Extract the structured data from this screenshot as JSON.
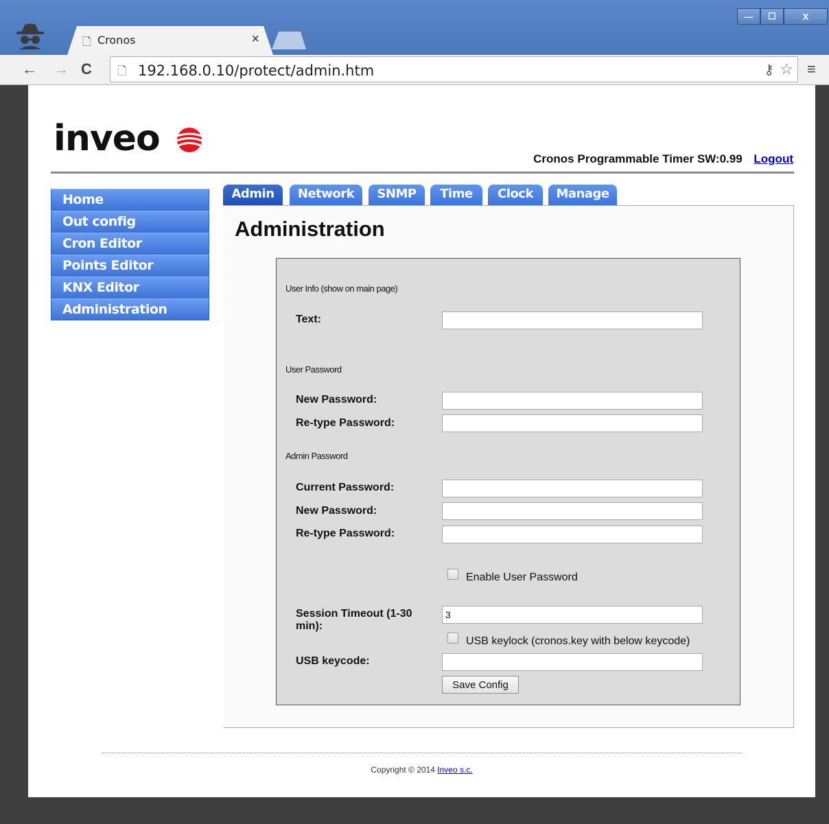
{
  "browser": {
    "tab_title": "Cronos",
    "tab_close": "×",
    "url": "192.168.0.10/protect/admin.htm",
    "window_controls": {
      "minimize": "—",
      "maximize": "☐",
      "close": "X"
    }
  },
  "header": {
    "logo_text": "inveo",
    "info": "Cronos Programmable Timer SW:0.99",
    "logout": "Logout"
  },
  "sidebar": {
    "items": [
      {
        "label": "Home"
      },
      {
        "label": "Out config"
      },
      {
        "label": "Cron Editor"
      },
      {
        "label": "Points Editor"
      },
      {
        "label": "KNX Editor"
      },
      {
        "label": "Administration"
      }
    ]
  },
  "tabs": [
    {
      "label": "Admin",
      "active": true
    },
    {
      "label": "Network"
    },
    {
      "label": "SNMP"
    },
    {
      "label": "Time"
    },
    {
      "label": "Clock"
    },
    {
      "label": "Manage"
    }
  ],
  "main": {
    "title": "Administration",
    "form": {
      "section_user_info": "User Info (show on main page)",
      "text_label": "Text:",
      "text_value": "",
      "section_user_password": "User Password",
      "user_new_password_label": "New Password:",
      "user_retype_password_label": "Re-type Password:",
      "section_admin_password": "Admin Password",
      "current_password_label": "Current Password:",
      "admin_new_password_label": "New Password:",
      "admin_retype_password_label": "Re-type Password:",
      "enable_user_password_label": "Enable User Password",
      "enable_user_password_checked": false,
      "session_timeout_label": "Session Timeout (1-30 min):",
      "session_timeout_value": "3",
      "usb_keylock_label": "USB keylock (cronos.key with below keycode)",
      "usb_keylock_checked": false,
      "usb_keycode_label": "USB keycode:",
      "usb_keycode_value": "",
      "save_button": "Save Config"
    }
  },
  "footer": {
    "copyright": "Copyright © 2014",
    "link": "Inveo s.c."
  },
  "colors": {
    "menu_blue": "#4a7fe0",
    "tab_active": "#2a5bc0",
    "logo_red": "#e8141e"
  }
}
